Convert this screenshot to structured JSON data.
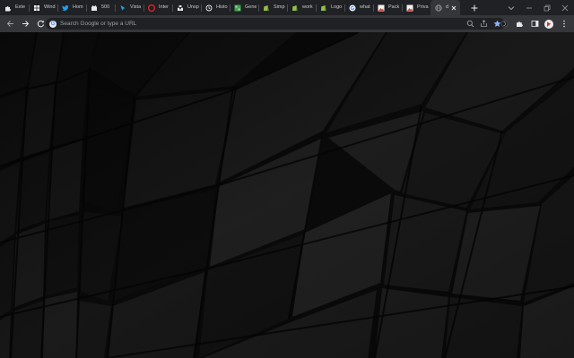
{
  "tabs": [
    {
      "label": "Exte",
      "icon": "puzzle-icon",
      "color": "#e8eaed"
    },
    {
      "label": "Wind",
      "icon": "windows-icon",
      "color": "#ffffff"
    },
    {
      "label": "Hom",
      "icon": "twitter-icon",
      "color": "#1da1f2"
    },
    {
      "label": "500",
      "icon": "github-icon",
      "color": "#e8eaed"
    },
    {
      "label": "Vista",
      "icon": "cursor-icon",
      "color": "#29a8e0"
    },
    {
      "label": "Inter",
      "icon": "opera-icon",
      "color": "#d9232d"
    },
    {
      "label": "Unsp",
      "icon": "unsplash-icon",
      "color": "#e8eaed"
    },
    {
      "label": "Histo",
      "icon": "history-icon",
      "color": "#e8eaed"
    },
    {
      "label": "Gene",
      "icon": "generator-icon",
      "color": "#3fa34d"
    },
    {
      "label": "Simp",
      "icon": "shopify-icon",
      "color": "#95bf47"
    },
    {
      "label": "work",
      "icon": "shopify-icon",
      "color": "#95bf47"
    },
    {
      "label": "Logo",
      "icon": "shopify-icon",
      "color": "#95bf47"
    },
    {
      "label": "what",
      "icon": "google-icon",
      "color": "#e8eaed"
    },
    {
      "label": "Pack",
      "icon": "image-icon",
      "color": "#d44638"
    },
    {
      "label": "Priva",
      "icon": "image-icon",
      "color": "#d44638"
    },
    {
      "label": "d",
      "icon": "globe-icon",
      "color": "#9aa0a6"
    }
  ],
  "active_tab_index": 15,
  "omnibox": {
    "placeholder": "Search Google or type a URL"
  },
  "colors": {
    "tabstrip": "#202124",
    "toolbar": "#35363a",
    "omnibox": "#202124",
    "star": "#8ab4f8",
    "content": "#080808"
  }
}
